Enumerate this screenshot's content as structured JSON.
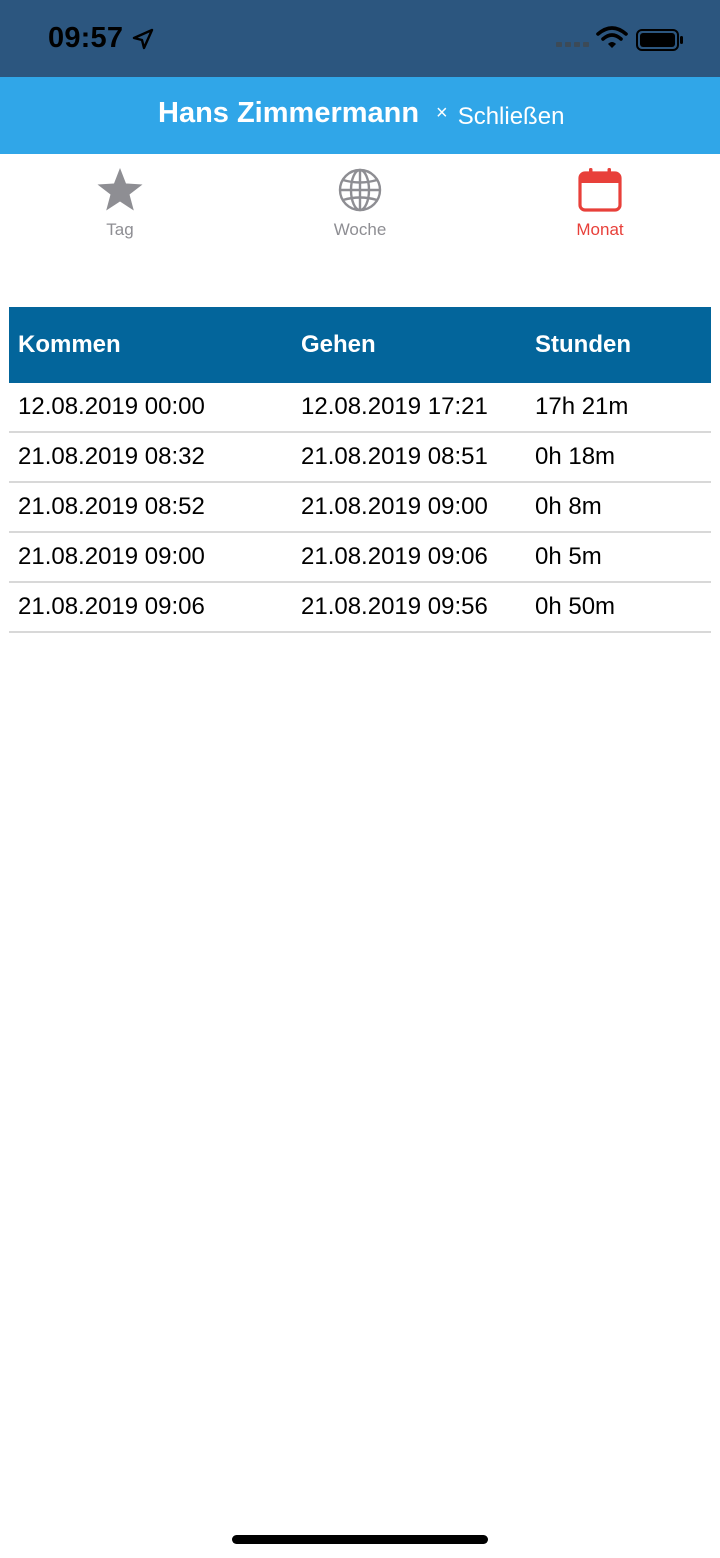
{
  "status_bar": {
    "time": "09:57",
    "icons": [
      "location-arrow-icon",
      "signal-icon",
      "wifi-icon",
      "battery-icon"
    ]
  },
  "nav": {
    "title": "Hans Zimmermann",
    "close_symbol": "×",
    "close_label": "Schließen"
  },
  "tabs": [
    {
      "label": "Tag",
      "icon": "star-icon",
      "active": false
    },
    {
      "label": "Woche",
      "icon": "globe-icon",
      "active": false
    },
    {
      "label": "Monat",
      "icon": "calendar-icon",
      "active": true
    }
  ],
  "table": {
    "headers": [
      "Kommen",
      "Gehen",
      "Stunden"
    ],
    "rows": [
      [
        "12.08.2019 00:00",
        "12.08.2019 17:21",
        "17h 21m"
      ],
      [
        "21.08.2019 08:32",
        "21.08.2019 08:51",
        "0h 18m"
      ],
      [
        "21.08.2019 08:52",
        "21.08.2019 09:00",
        "0h 8m"
      ],
      [
        "21.08.2019 09:00",
        "21.08.2019 09:06",
        "0h 5m"
      ],
      [
        "21.08.2019 09:06",
        "21.08.2019 09:56",
        "0h 50m"
      ]
    ]
  },
  "colors": {
    "status_bar": "#2c567f",
    "nav_bar": "#30a6e8",
    "table_header": "#03659b",
    "tab_active": "#e8403a",
    "tab_inactive": "#8e8e93"
  }
}
